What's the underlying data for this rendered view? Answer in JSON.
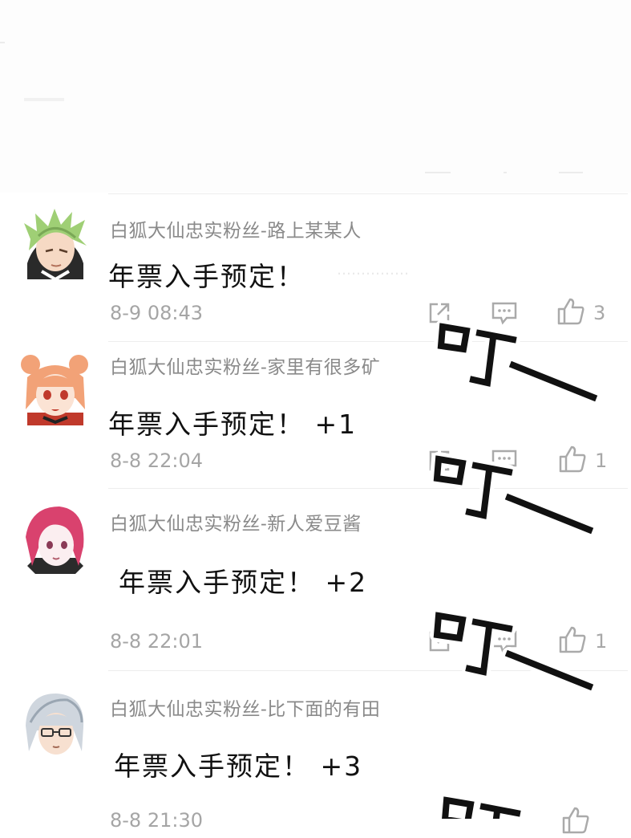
{
  "comments": [
    {
      "user": "白狐大仙忠实粉丝-路上某某人",
      "text": "年票入手预定！",
      "time": "8-9 08:43",
      "likes": "3",
      "avatar": "green-hair-avatar"
    },
    {
      "user": "白狐大仙忠实粉丝-家里有很多矿",
      "text": "年票入手预定！ +1",
      "time": "8-8 22:04",
      "likes": "1",
      "avatar": "orange-bun-avatar"
    },
    {
      "user": "白狐大仙忠实粉丝-新人爱豆酱",
      "text": "年票入手预定！ +2",
      "time": "8-8 22:01",
      "likes": "1",
      "avatar": "pink-hair-avatar"
    },
    {
      "user": "白狐大仙忠实粉丝-比下面的有田",
      "text": "年票入手预定！ +3",
      "time": "8-8 21:30",
      "likes": "",
      "avatar": "silver-hair-glasses-avatar"
    }
  ],
  "sfx": {
    "text": "叮一"
  },
  "colors": {
    "text": "#111111",
    "username": "#8a8a8a",
    "meta": "#a5a5a5",
    "divider": "#ededed"
  }
}
